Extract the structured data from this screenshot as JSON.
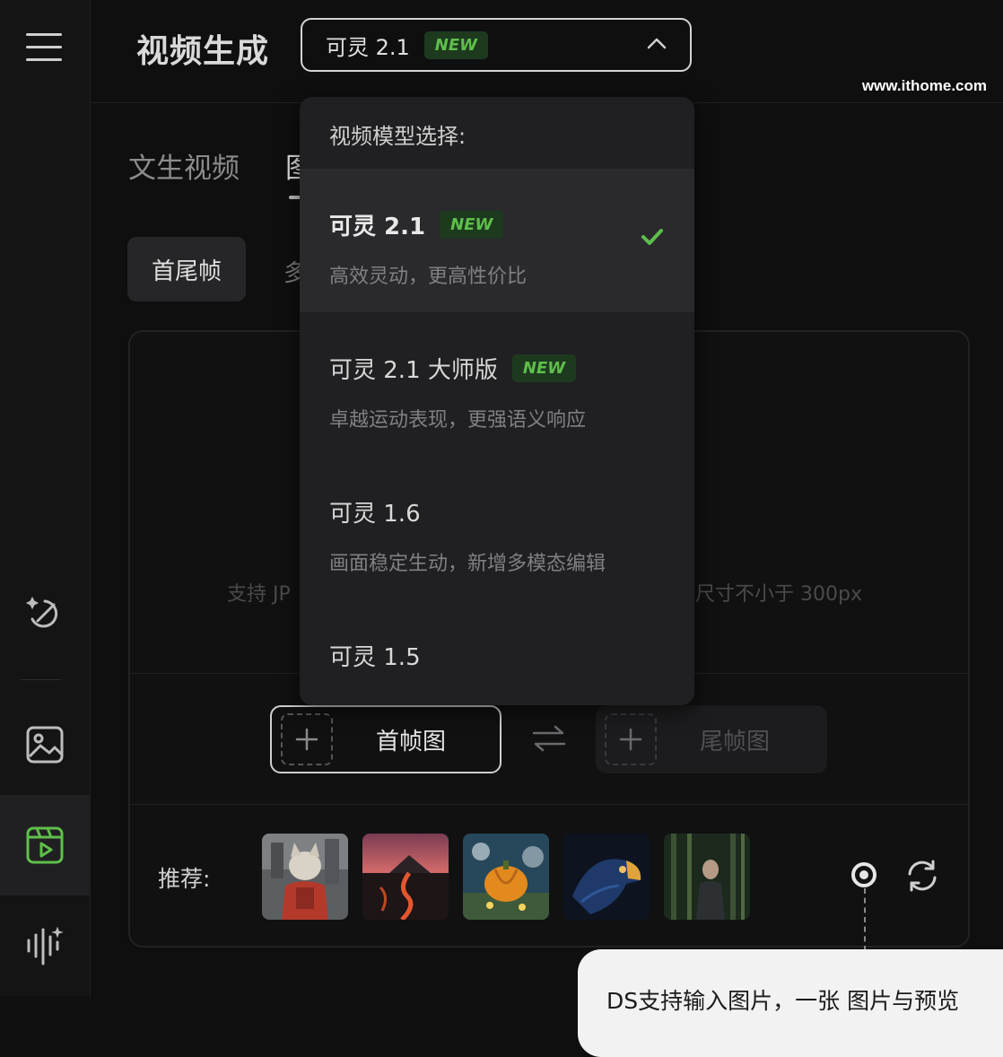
{
  "app": {
    "page_title": "视频生成",
    "watermark": "www.ithome.com"
  },
  "model_select": {
    "current": "可灵 2.1",
    "badge": "NEW"
  },
  "tabs": [
    {
      "label": "文生视频"
    },
    {
      "label": "图"
    }
  ],
  "subtabs": [
    {
      "label": "首尾帧"
    },
    {
      "label": "多"
    }
  ],
  "upload": {
    "hint_left": "支持 JP",
    "hint_right": "尺寸不小于 300px",
    "first_frame": "首帧图",
    "last_frame": "尾帧图"
  },
  "recommend": {
    "label": "推荐:"
  },
  "tooltip": {
    "text": "DS支持输入图片，一张 图片与预览"
  },
  "dropdown": {
    "header": "视频模型选择:",
    "options": [
      {
        "name": "可灵 2.1",
        "badge": "NEW",
        "desc": "高效灵动，更高性价比",
        "selected": true
      },
      {
        "name": "可灵 2.1 大师版",
        "badge": "NEW",
        "desc": "卓越运动表现，更强语义响应",
        "selected": false
      },
      {
        "name": "可灵 1.6",
        "badge": "",
        "desc": "画面稳定生动，新增多模态编辑",
        "selected": false
      },
      {
        "name": "可灵 1.5",
        "badge": "",
        "desc": "",
        "selected": false
      }
    ]
  },
  "colors": {
    "accent_green": "#5fbe4b",
    "badge_bg": "#1d3a1f",
    "background": "#0f0f10",
    "dropdown_bg": "#202022"
  },
  "icons": {
    "sidebar": [
      "menu-icon",
      "magic-brush-icon",
      "image-icon",
      "video-icon",
      "audio-wave-icon"
    ],
    "select": "chevron-up-icon",
    "check": "check-icon",
    "swap": "swap-icon",
    "pin": "pin-icon",
    "refresh": "refresh-icon"
  }
}
